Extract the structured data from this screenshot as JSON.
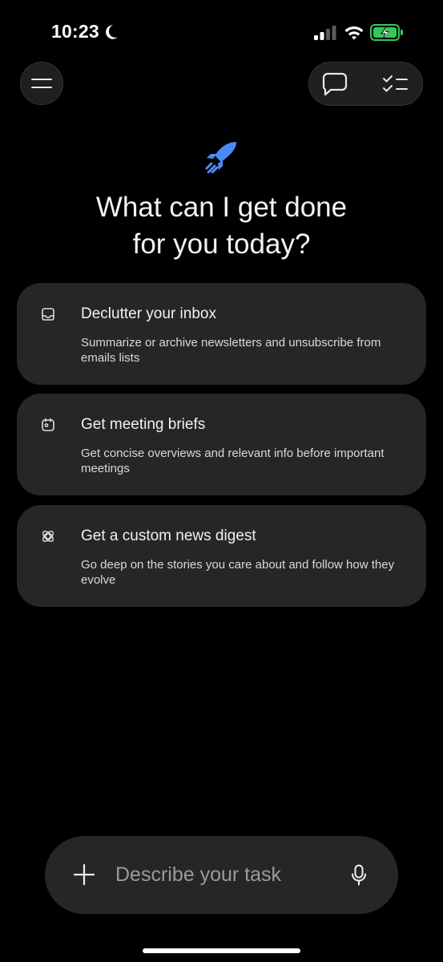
{
  "status_bar": {
    "time": "10:23",
    "icons": [
      "moon-icon",
      "signal-icon",
      "wifi-icon",
      "battery-charging-icon"
    ],
    "battery_color": "#34c759"
  },
  "top_controls": {
    "left": "menu-icon",
    "right": [
      "chat-icon",
      "tasks-icon"
    ]
  },
  "hero": {
    "icon": "rocket-icon",
    "icon_color": "#4a8cf7",
    "headline_line1": "What can I get done",
    "headline_line2": "for you today?"
  },
  "suggestions": [
    {
      "icon": "inbox-icon",
      "title": "Declutter your inbox",
      "description": "Summarize or archive newsletters and unsubscribe from emails lists"
    },
    {
      "icon": "calendar-icon",
      "title": "Get meeting briefs",
      "description": "Get concise overviews and relevant info before important meetings"
    },
    {
      "icon": "news-icon",
      "title": "Get a custom news digest",
      "description": "Go deep on the stories you care about and follow how they evolve"
    }
  ],
  "composer": {
    "placeholder": "Describe your task",
    "value": "",
    "icons": [
      "plus-icon",
      "mic-icon"
    ]
  },
  "colors": {
    "background": "#000000",
    "card": "#262628",
    "accent": "#4a8cf7"
  }
}
